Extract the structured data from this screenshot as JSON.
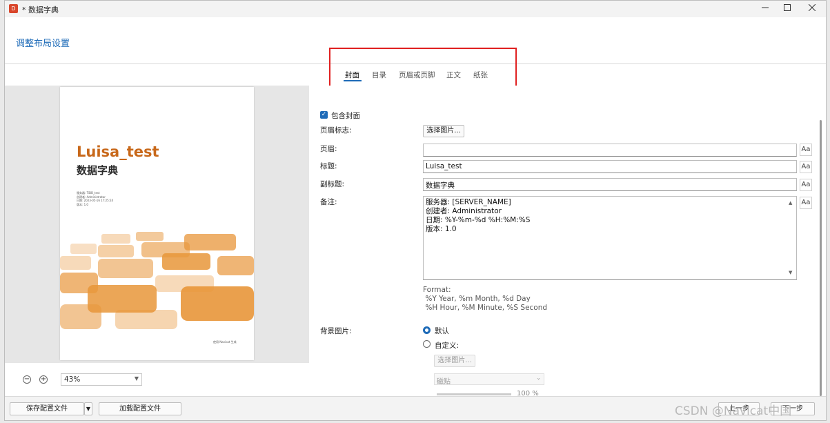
{
  "window": {
    "title": "* 数据字典",
    "app_icon": "D",
    "controls": [
      "minimize-icon",
      "maximize-icon",
      "close-icon"
    ]
  },
  "header": {
    "title": "调整布局设置"
  },
  "tabs": [
    {
      "label": "封面",
      "active": true
    },
    {
      "label": "目录",
      "active": false
    },
    {
      "label": "页眉或页脚",
      "active": false
    },
    {
      "label": "正文",
      "active": false
    },
    {
      "label": "纸张",
      "active": false
    }
  ],
  "preview": {
    "cover_title": "Luisa_test",
    "cover_subtitle": "数据字典",
    "meta_lines": [
      "服务器: TiDB_test",
      "创建者: Administrator",
      "日期: 2023-05-16 17:25:24",
      "版本: 1.0"
    ],
    "footer": "使用 Navicat 生成",
    "accent_color": "#e8963a"
  },
  "zoom": {
    "value": "43%",
    "minus": "−",
    "plus": "+"
  },
  "form": {
    "include_cover": {
      "label": "包含封面",
      "checked": true
    },
    "header_logo": {
      "label": "页眉标志:",
      "button": "选择图片..."
    },
    "header": {
      "label": "页眉:",
      "value": ""
    },
    "title": {
      "label": "标题:",
      "value": "Luisa_test"
    },
    "subtitle": {
      "label": "副标题:",
      "value": "数据字典"
    },
    "notes": {
      "label": "备注:",
      "lines": [
        "服务器: [SERVER_NAME]",
        "创建者: Administrator",
        "日期: %Y-%m-%d %H:%M:%S",
        "版本: 1.0"
      ]
    },
    "format": {
      "lines": [
        "Format:",
        " %Y Year, %m Month, %d Day",
        " %H Hour, %M Minute, %S Second"
      ]
    },
    "font_button": "Aa",
    "background": {
      "label": "背景图片:",
      "default_label": "默认",
      "custom_label": "自定义:",
      "select_button": "选择图片...",
      "fill_mode": "磁贴",
      "opacity": "100",
      "unit": "%",
      "selected": "default"
    }
  },
  "footer": {
    "save_config": "保存配置文件",
    "load_config": "加载配置文件",
    "prev": "上一步",
    "next": "下一步"
  },
  "watermark": "CSDN @Navicat中国"
}
